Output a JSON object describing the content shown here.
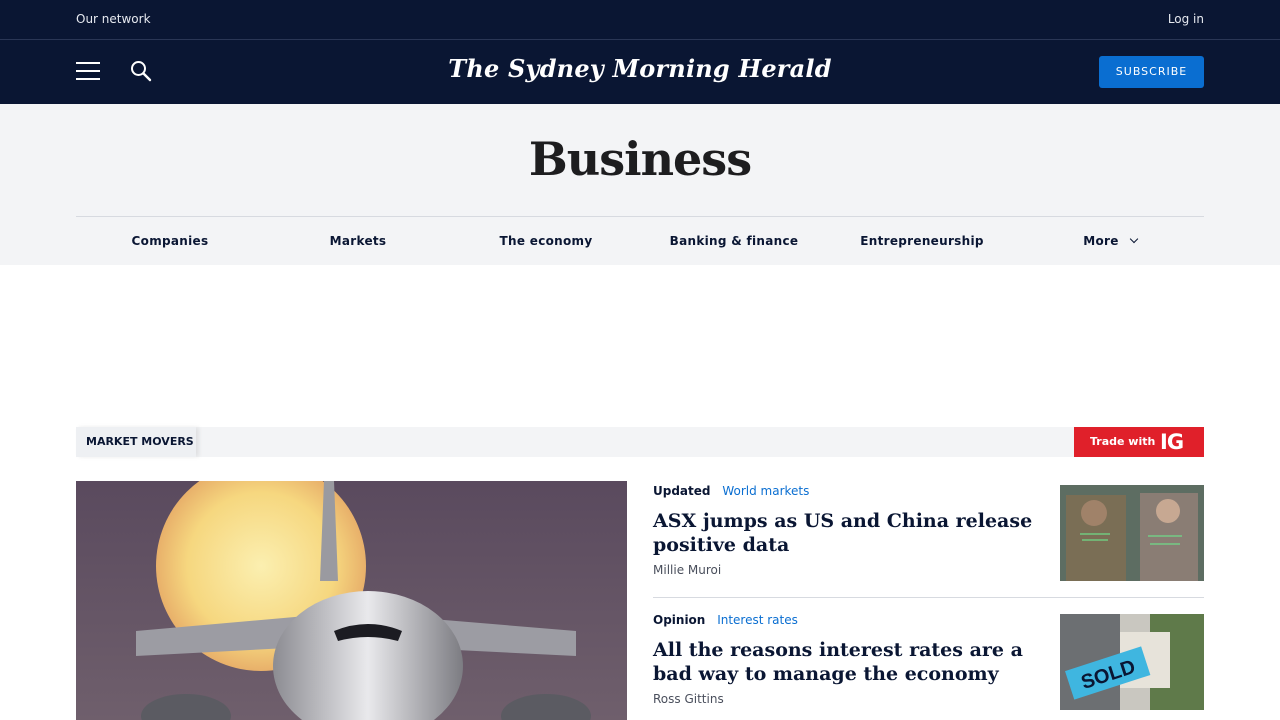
{
  "topbar": {
    "network": "Our network",
    "login": "Log in"
  },
  "header": {
    "masthead": "The Sydney Morning Herald",
    "subscribe": "SUBSCRIBE"
  },
  "section": {
    "title": "Business",
    "nav": [
      "Companies",
      "Markets",
      "The economy",
      "Banking & finance",
      "Entrepreneurship",
      "More"
    ]
  },
  "movers": {
    "label": "MARKET MOVERS",
    "trade_with": "Trade with",
    "ig_logo": "IG"
  },
  "stories": [
    {
      "kicker": "Updated",
      "tag": "World markets",
      "headline": "ASX jumps as US and China release positive data",
      "author": "Millie Muroi"
    },
    {
      "kicker": "Opinion",
      "tag": "Interest rates",
      "headline": "All the reasons interest rates are a bad way to manage the economy",
      "author": "Ross Gittins",
      "badge": "SOLD"
    }
  ],
  "colors": {
    "navy": "#0a1633",
    "accent": "#0a6ed1",
    "ig_red": "#e0202a"
  }
}
